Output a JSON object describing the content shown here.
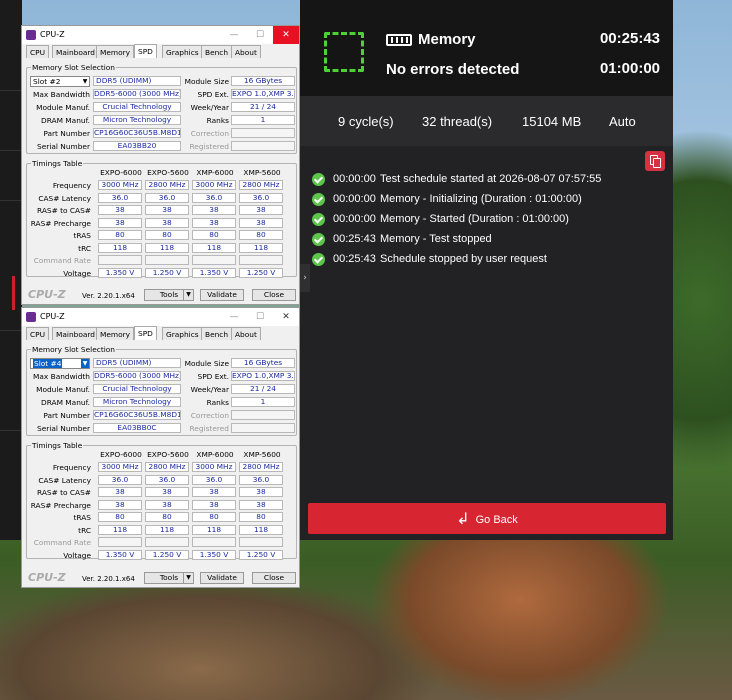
{
  "app": {
    "title": "Memory",
    "status": "No errors detected",
    "elapsed": "00:25:43",
    "duration": "01:00:00",
    "stats": {
      "cycles": "9 cycle(s)",
      "threads": "32 thread(s)",
      "memory": "15104 MB",
      "mode": "Auto"
    },
    "log": [
      {
        "time": "00:00:00",
        "msg": "Test schedule started at 2026-08-07 07:57:55"
      },
      {
        "time": "00:00:00",
        "msg": "Memory - Initializing (Duration : 01:00:00)"
      },
      {
        "time": "00:00:00",
        "msg": "Memory - Started (Duration : 01:00:00)"
      },
      {
        "time": "00:25:43",
        "msg": "Memory - Test stopped"
      },
      {
        "time": "00:25:43",
        "msg": "Schedule stopped by user request"
      }
    ],
    "go_back": "Go Back",
    "colors": {
      "accent": "#d72532",
      "ok": "#5cc54a",
      "bg": "#222224"
    }
  },
  "cpuz": [
    {
      "title": "CPU-Z",
      "tabs": [
        "CPU",
        "Mainboard",
        "Memory",
        "SPD",
        "Graphics",
        "Bench",
        "About"
      ],
      "active_tab": "SPD",
      "group_slot": "Memory Slot Selection",
      "slot": "Slot #2",
      "type": "DDR5 (UDIMM)",
      "labels": {
        "module_size": "Module Size",
        "max_bw": "Max Bandwidth",
        "spd_ext": "SPD Ext.",
        "manuf": "Module Manuf.",
        "week": "Week/Year",
        "dram": "DRAM Manuf.",
        "ranks": "Ranks",
        "part": "Part Number",
        "correction": "Correction",
        "serial": "Serial Number",
        "registered": "Registered"
      },
      "module_size": "16 GBytes",
      "max_bw": "DDR5-6000 (3000 MHz)",
      "spd_ext": "EXPO 1.0,XMP 3.0",
      "manuf": "Crucial Technology",
      "week": "21 / 24",
      "dram": "Micron Technology",
      "ranks": "1",
      "part": "CP16G60C36U5B.M8D1",
      "serial": "EA03BB20",
      "group_timing": "Timings Table",
      "cols": [
        "EXPO-6000",
        "EXPO-5600",
        "XMP-6000",
        "XMP-5600"
      ],
      "rows": [
        {
          "label": "Frequency",
          "vals": [
            "3000 MHz",
            "2800 MHz",
            "3000 MHz",
            "2800 MHz"
          ]
        },
        {
          "label": "CAS# Latency",
          "vals": [
            "36.0",
            "36.0",
            "36.0",
            "36.0"
          ]
        },
        {
          "label": "RAS# to CAS#",
          "vals": [
            "38",
            "38",
            "38",
            "38"
          ]
        },
        {
          "label": "RAS# Precharge",
          "vals": [
            "38",
            "38",
            "38",
            "38"
          ]
        },
        {
          "label": "tRAS",
          "vals": [
            "80",
            "80",
            "80",
            "80"
          ]
        },
        {
          "label": "tRC",
          "vals": [
            "118",
            "118",
            "118",
            "118"
          ]
        },
        {
          "label": "Command Rate",
          "vals": [
            "",
            "",
            "",
            ""
          ]
        },
        {
          "label": "Voltage",
          "vals": [
            "1.350 V",
            "1.250 V",
            "1.350 V",
            "1.250 V"
          ]
        }
      ],
      "logo": "CPU-Z",
      "version": "Ver. 2.20.1.x64",
      "tools": "Tools",
      "validate": "Validate",
      "close": "Close"
    },
    {
      "title": "CPU-Z",
      "tabs": [
        "CPU",
        "Mainboard",
        "Memory",
        "SPD",
        "Graphics",
        "Bench",
        "About"
      ],
      "active_tab": "SPD",
      "group_slot": "Memory Slot Selection",
      "slot": "Slot #4",
      "type": "DDR5 (UDIMM)",
      "labels": {
        "module_size": "Module Size",
        "max_bw": "Max Bandwidth",
        "spd_ext": "SPD Ext.",
        "manuf": "Module Manuf.",
        "week": "Week/Year",
        "dram": "DRAM Manuf.",
        "ranks": "Ranks",
        "part": "Part Number",
        "correction": "Correction",
        "serial": "Serial Number",
        "registered": "Registered"
      },
      "module_size": "16 GBytes",
      "max_bw": "DDR5-6000 (3000 MHz)",
      "spd_ext": "EXPO 1.0,XMP 3.0",
      "manuf": "Crucial Technology",
      "week": "21 / 24",
      "dram": "Micron Technology",
      "ranks": "1",
      "part": "CP16G60C36U5B.M8D1",
      "serial": "EA03BB0C",
      "group_timing": "Timings Table",
      "cols": [
        "EXPO-6000",
        "EXPO-5600",
        "XMP-6000",
        "XMP-5600"
      ],
      "rows": [
        {
          "label": "Frequency",
          "vals": [
            "3000 MHz",
            "2800 MHz",
            "3000 MHz",
            "2800 MHz"
          ]
        },
        {
          "label": "CAS# Latency",
          "vals": [
            "36.0",
            "36.0",
            "36.0",
            "36.0"
          ]
        },
        {
          "label": "RAS# to CAS#",
          "vals": [
            "38",
            "38",
            "38",
            "38"
          ]
        },
        {
          "label": "RAS# Precharge",
          "vals": [
            "38",
            "38",
            "38",
            "38"
          ]
        },
        {
          "label": "tRAS",
          "vals": [
            "80",
            "80",
            "80",
            "80"
          ]
        },
        {
          "label": "tRC",
          "vals": [
            "118",
            "118",
            "118",
            "118"
          ]
        },
        {
          "label": "Command Rate",
          "vals": [
            "",
            "",
            "",
            ""
          ]
        },
        {
          "label": "Voltage",
          "vals": [
            "1.350 V",
            "1.250 V",
            "1.350 V",
            "1.250 V"
          ]
        }
      ],
      "logo": "CPU-Z",
      "version": "Ver. 2.20.1.x64",
      "tools": "Tools",
      "validate": "Validate",
      "close": "Close"
    }
  ]
}
